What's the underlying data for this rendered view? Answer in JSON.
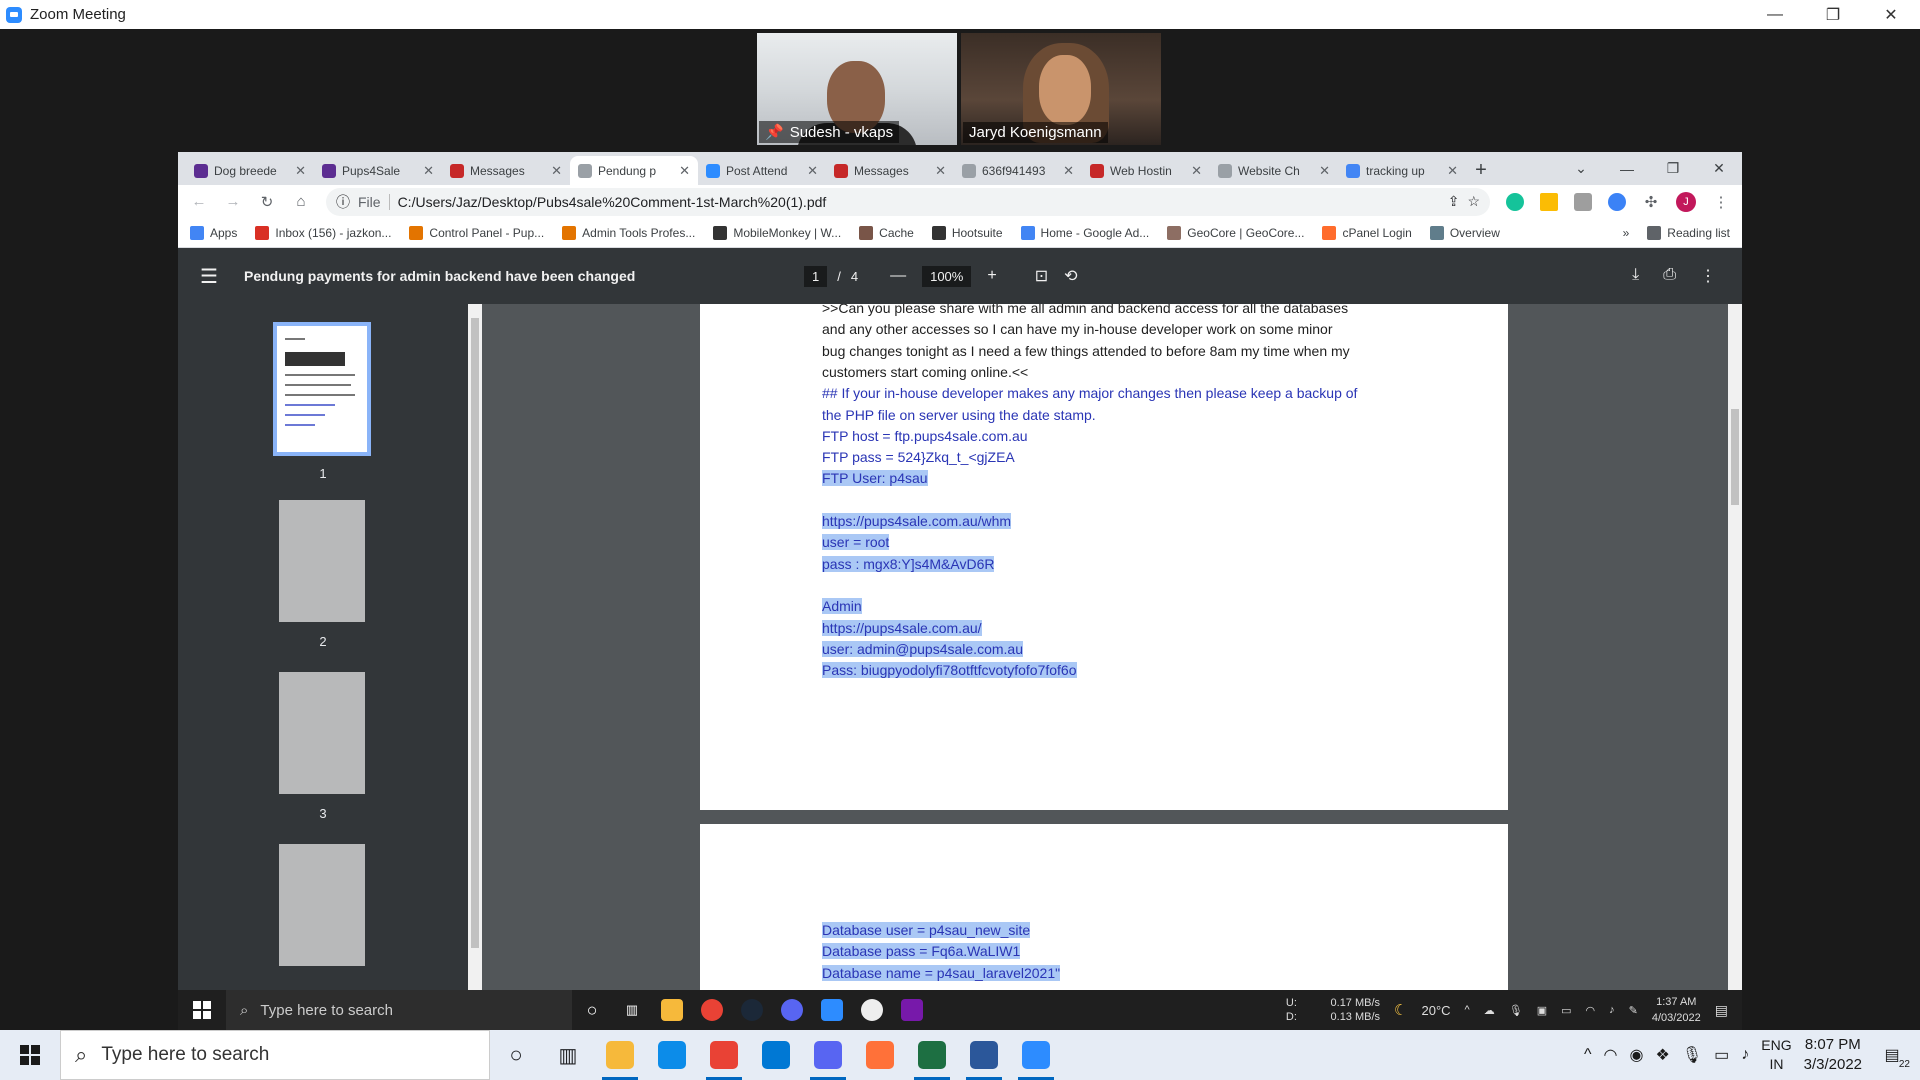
{
  "zoom": {
    "title": "Zoom Meeting",
    "participants": [
      {
        "name": "Sudesh - vkaps"
      },
      {
        "name": "Jaryd Koenigsmann"
      }
    ],
    "controls": {
      "minimize": "—",
      "restore": "❐",
      "close": "✕"
    }
  },
  "chrome": {
    "tabs": [
      {
        "label": "Dog breede",
        "icon_color": "#5c2d91"
      },
      {
        "label": "Pups4Sale",
        "icon_color": "#5c2d91"
      },
      {
        "label": "Messages",
        "icon_color": "#c62828"
      },
      {
        "label": "Pendung p",
        "icon_color": "#9aa0a6"
      },
      {
        "label": "Post Attend",
        "icon_color": "#2d8cff"
      },
      {
        "label": "Messages",
        "icon_color": "#c62828"
      },
      {
        "label": "636f941493",
        "icon_color": "#9aa0a6"
      },
      {
        "label": "Web Hostin",
        "icon_color": "#c62828"
      },
      {
        "label": "Website Ch",
        "icon_color": "#9aa0a6"
      },
      {
        "label": "tracking up",
        "icon_color": "#4285f4"
      }
    ],
    "active_tab_index": 3,
    "omnibox": {
      "scheme_label": "File",
      "url": "C:/Users/Jaz/Desktop/Pubs4sale%20Comment-1st-March%20(1).pdf"
    },
    "bookmarks": [
      {
        "label": "Apps",
        "icon_color": "#4285f4"
      },
      {
        "label": "Inbox (156) - jazkon...",
        "icon_color": "#d93025"
      },
      {
        "label": "Control Panel - Pup...",
        "icon_color": "#e37400"
      },
      {
        "label": "Admin Tools Profes...",
        "icon_color": "#e37400"
      },
      {
        "label": "MobileMonkey | W...",
        "icon_color": "#333333"
      },
      {
        "label": "Cache",
        "icon_color": "#795548"
      },
      {
        "label": "Hootsuite",
        "icon_color": "#333333"
      },
      {
        "label": "Home - Google Ad...",
        "icon_color": "#4285f4"
      },
      {
        "label": "GeoCore | GeoCore...",
        "icon_color": "#8d6e63"
      },
      {
        "label": "cPanel Login",
        "icon_color": "#ff6c2c"
      },
      {
        "label": "Overview",
        "icon_color": "#607d8b"
      }
    ],
    "bookmarks_overflow": "»",
    "reading_list": "Reading list"
  },
  "pdf": {
    "title": "Pendung payments for admin backend have been changed",
    "page_current": "1",
    "page_separator": "/",
    "page_total": "4",
    "zoom": "100%",
    "thumbnails": [
      "1",
      "2",
      "3"
    ],
    "page1_lines": [
      {
        "text": ">>Can you please share with me all admin and backend access for all the databases",
        "color": "black"
      },
      {
        "text": "and any other accesses so I can have my in-house developer work on some minor",
        "color": "black"
      },
      {
        "text": "bug changes tonight as I need a few things attended to before 8am my time when my",
        "color": "black"
      },
      {
        "text": "customers start coming online.<<",
        "color": "black"
      },
      {
        "text": "## If your in-house developer makes any major changes then please keep a backup of",
        "color": "blue"
      },
      {
        "text": "the PHP file on server using the date stamp.",
        "color": "blue"
      },
      {
        "text": "FTP host = ftp.pups4sale.com.au",
        "color": "blue"
      },
      {
        "text": "FTP    pass = 524}Zkq_t_<gjZEA",
        "color": "blue"
      },
      {
        "text": "FTP    User: p4sau",
        "color": "blue",
        "highlight": true
      },
      {
        "text": "",
        "color": "blue"
      },
      {
        "text": "https://pups4sale.com.au/whm",
        "color": "blue",
        "highlight": true
      },
      {
        "text": "user = root",
        "color": "blue",
        "highlight": true
      },
      {
        "text": "pass    : mgx8:Y]s4M&AvD6R",
        "color": "blue",
        "highlight": true
      },
      {
        "text": "",
        "color": "blue"
      },
      {
        "text": "Admin",
        "color": "blue",
        "highlight": true
      },
      {
        "text": "https://pups4sale.com.au/",
        "color": "blue",
        "highlight": true
      },
      {
        "text": "user: admin@pups4sale.com.au",
        "color": "blue",
        "highlight": true
      },
      {
        "text": "Pass: biugpyodolyfi78otftfcvotyfofo7fof6o",
        "color": "blue",
        "highlight": true
      }
    ],
    "page2_lines": [
      {
        "text": "Database user =       p4sau_new_site",
        "color": "blue",
        "highlight": true
      },
      {
        "text": "Database pass = Fq6a.WaLIW1",
        "color": "blue",
        "highlight": true
      },
      {
        "text": "Database name = p4sau_laravel2021\"",
        "color": "blue",
        "highlight": true
      }
    ]
  },
  "inner_taskbar": {
    "search_placeholder": "Type here to search",
    "net_up": "U:",
    "net_down": "D:",
    "speed_up": "0.17 MB/s",
    "speed_down": "0.13 MB/s",
    "weather": "20°C",
    "time": "1:37 AM",
    "date": "4/03/2022"
  },
  "taskbar": {
    "search_placeholder": "Type here to search",
    "lang1": "ENG",
    "lang2": "IN",
    "time": "8:07 PM",
    "date": "3/3/2022",
    "notifications": "22",
    "app_colors": [
      "#f6b93b",
      "#0c8ce9",
      "#e94235",
      "#0078d4",
      "#5865f2",
      "#ff7139",
      "#1d6f42",
      "#2b579a",
      "#2d8cff"
    ]
  }
}
